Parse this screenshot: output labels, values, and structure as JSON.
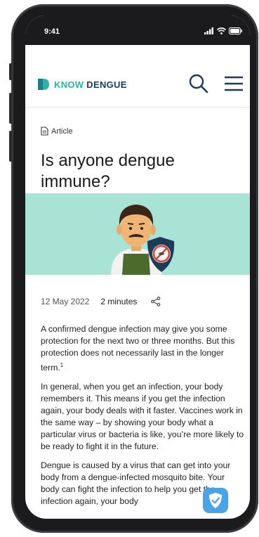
{
  "status_bar": {
    "time": "9:41"
  },
  "nav": {
    "logo_know": "KNOW",
    "logo_dengue": "DENGUE"
  },
  "article": {
    "tag": "Article",
    "title": "Is anyone dengue immune?",
    "date": "12 May 2022",
    "read_time": "2 minutes",
    "paragraphs": [
      "A confirmed dengue infection may give you some protection for the next two or three months. But this protection does not necessarily last in the longer term.",
      "In general, when you get an infection, your body remembers it. This means if you get the infection again, your body deals with it faster. Vaccines work in the same way – by showing your body what a particular virus or bacteria is like, you’re more likely to be ready to fight it in the future.",
      "Dengue is caused by a virus that can get into your body from a dengue-infected mosquito bite. Your body can fight the infection to help you get the infection again, your body"
    ],
    "footnote": "1"
  },
  "colors": {
    "hero_bg": "#a9e3d6",
    "brand_teal": "#2fb3a5",
    "brand_navy": "#1c3b5a",
    "fab": "#4aa3e6"
  }
}
